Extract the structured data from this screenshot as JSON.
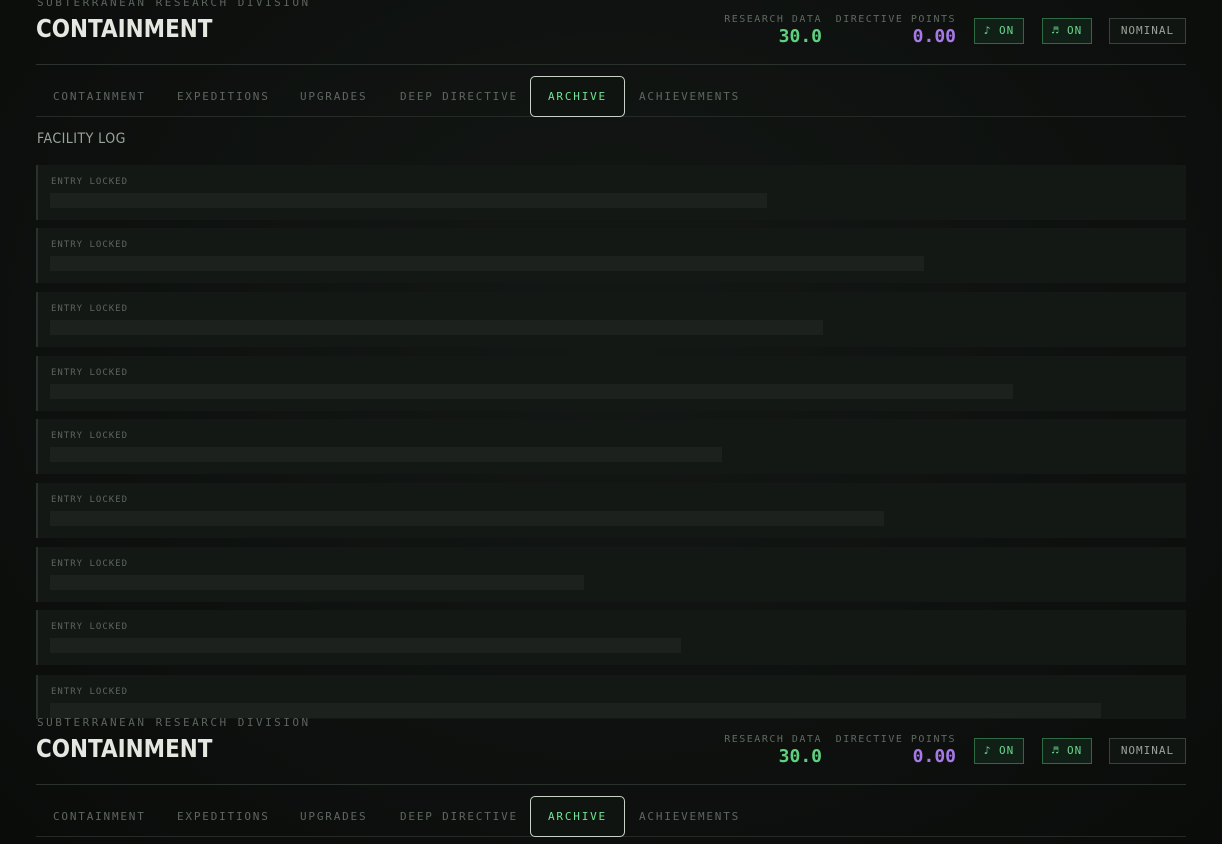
{
  "header": {
    "subtitle": "SUBTERRANEAN RESEARCH DIVISION",
    "title": "CONTAINMENT",
    "research_label": "RESEARCH DATA",
    "research_value": "30.0",
    "directive_label": "DIRECTIVE POINTS",
    "directive_value": "0.00",
    "sfx_toggle": "♪ ON",
    "music_toggle": "♬ ON",
    "status": "NOMINAL"
  },
  "tabs": [
    {
      "label": "CONTAINMENT",
      "active": false
    },
    {
      "label": "EXPEDITIONS",
      "active": false
    },
    {
      "label": "UPGRADES",
      "active": false
    },
    {
      "label": "DEEP DIRECTIVE",
      "active": false
    },
    {
      "label": "ARCHIVE",
      "active": true
    },
    {
      "label": "ACHIEVEMENTS",
      "active": false
    }
  ],
  "archive": {
    "section_title": "FACILITY LOG",
    "entries": [
      {
        "label": "ENTRY LOCKED",
        "redacted_fraction": 0.64
      },
      {
        "label": "ENTRY LOCKED",
        "redacted_fraction": 0.78
      },
      {
        "label": "ENTRY LOCKED",
        "redacted_fraction": 0.69
      },
      {
        "label": "ENTRY LOCKED",
        "redacted_fraction": 0.86
      },
      {
        "label": "ENTRY LOCKED",
        "redacted_fraction": 0.6
      },
      {
        "label": "ENTRY LOCKED",
        "redacted_fraction": 0.745
      },
      {
        "label": "ENTRY LOCKED",
        "redacted_fraction": 0.477
      },
      {
        "label": "ENTRY LOCKED",
        "redacted_fraction": 0.563
      },
      {
        "label": "ENTRY LOCKED",
        "redacted_fraction": 0.938
      }
    ]
  },
  "colors": {
    "research": "#5fd07f",
    "directive": "#a779e6",
    "active_tab": "#6fe393"
  }
}
